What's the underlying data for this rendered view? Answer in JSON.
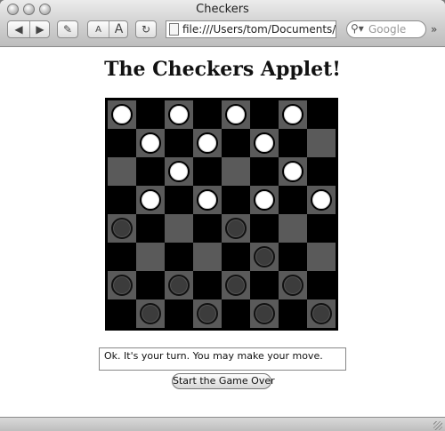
{
  "window": {
    "title": "Checkers"
  },
  "toolbar": {
    "text_smaller": "A",
    "text_bigger": "A",
    "url": "file:///Users/tom/Documents/D",
    "search_placeholder": "Google",
    "overflow": "»"
  },
  "page": {
    "heading": "The Checkers Applet!",
    "status_message": "Ok. It's your turn. You may make your move.",
    "restart_label": "Start the Game Over"
  },
  "board": {
    "size": 8,
    "pieces": [
      {
        "row": 0,
        "col": 0,
        "color": "white"
      },
      {
        "row": 0,
        "col": 2,
        "color": "white"
      },
      {
        "row": 0,
        "col": 4,
        "color": "white"
      },
      {
        "row": 0,
        "col": 6,
        "color": "white"
      },
      {
        "row": 1,
        "col": 1,
        "color": "white"
      },
      {
        "row": 1,
        "col": 3,
        "color": "white"
      },
      {
        "row": 1,
        "col": 5,
        "color": "white"
      },
      {
        "row": 2,
        "col": 2,
        "color": "white"
      },
      {
        "row": 2,
        "col": 6,
        "color": "white"
      },
      {
        "row": 3,
        "col": 1,
        "color": "white"
      },
      {
        "row": 3,
        "col": 3,
        "color": "white"
      },
      {
        "row": 3,
        "col": 5,
        "color": "white"
      },
      {
        "row": 3,
        "col": 7,
        "color": "white"
      },
      {
        "row": 4,
        "col": 0,
        "color": "black"
      },
      {
        "row": 4,
        "col": 4,
        "color": "black"
      },
      {
        "row": 5,
        "col": 5,
        "color": "black"
      },
      {
        "row": 6,
        "col": 0,
        "color": "black"
      },
      {
        "row": 6,
        "col": 2,
        "color": "black"
      },
      {
        "row": 6,
        "col": 4,
        "color": "black"
      },
      {
        "row": 6,
        "col": 6,
        "color": "black"
      },
      {
        "row": 7,
        "col": 1,
        "color": "black"
      },
      {
        "row": 7,
        "col": 3,
        "color": "black"
      },
      {
        "row": 7,
        "col": 5,
        "color": "black"
      },
      {
        "row": 7,
        "col": 7,
        "color": "black"
      }
    ]
  },
  "colors": {
    "light_square": "#5a5a5a",
    "dark_square": "#000000"
  },
  "icons": [
    "back-icon",
    "forward-icon",
    "pencil-icon",
    "reload-icon",
    "page-icon",
    "search-glass-icon"
  ]
}
